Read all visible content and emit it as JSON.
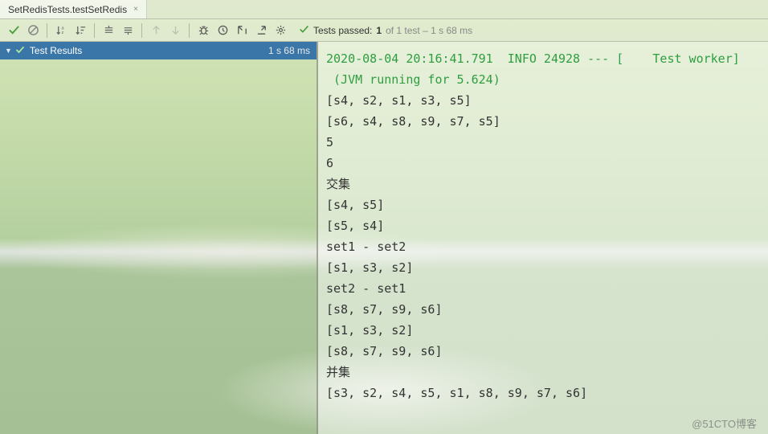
{
  "tab": {
    "title": "SetRedisTests.testSetRedis"
  },
  "toolbar": {
    "items": [
      {
        "name": "check-icon",
        "title": "Show Passed",
        "color": "#4a9e3a",
        "disabled": false
      },
      {
        "name": "no-entry-icon",
        "title": "Disable",
        "color": "#777",
        "disabled": false
      },
      {
        "name": "sort-az-icon",
        "title": "Sort",
        "color": "#666",
        "disabled": false
      },
      {
        "name": "sort-duration-icon",
        "title": "Sort by Duration",
        "color": "#666",
        "disabled": false
      },
      {
        "name": "expand-all-icon",
        "title": "Expand All",
        "color": "#666",
        "disabled": false
      },
      {
        "name": "collapse-all-icon",
        "title": "Collapse All",
        "color": "#666",
        "disabled": false
      },
      {
        "name": "up-icon",
        "title": "Previous",
        "color": "#999",
        "disabled": true
      },
      {
        "name": "down-icon",
        "title": "Next",
        "color": "#999",
        "disabled": true
      },
      {
        "name": "bug-icon",
        "title": "Test Runner",
        "color": "#555",
        "disabled": false
      },
      {
        "name": "history-icon",
        "title": "History",
        "color": "#555",
        "disabled": false
      },
      {
        "name": "import-icon",
        "title": "Import",
        "color": "#555",
        "disabled": false
      },
      {
        "name": "export-icon",
        "title": "Export",
        "color": "#555",
        "disabled": false
      },
      {
        "name": "gear-icon",
        "title": "Settings",
        "color": "#555",
        "disabled": false
      }
    ]
  },
  "summary": {
    "prefix": "Tests passed:",
    "count": "1",
    "rest": " of 1 test – 1 s 68 ms"
  },
  "tree": {
    "root": {
      "label": "Test Results",
      "time": "1 s 68 ms"
    }
  },
  "console": {
    "green_line": "2020-08-04 20:16:41.791  INFO 24928 --- [    Test worker]",
    "green_line2": " (JVM running for 5.624)",
    "lines": [
      "[s4, s2, s1, s3, s5]",
      "[s6, s4, s8, s9, s7, s5]",
      "5",
      "6",
      "交集",
      "[s4, s5]",
      "[s5, s4]",
      "set1 - set2",
      "[s1, s3, s2]",
      "set2 - set1",
      "[s8, s7, s9, s6]",
      "[s1, s3, s2]",
      "[s8, s7, s9, s6]",
      "并集",
      "[s3, s2, s4, s5, s1, s8, s9, s7, s6]"
    ]
  },
  "watermark": "@51CTO博客",
  "watermark2": ""
}
